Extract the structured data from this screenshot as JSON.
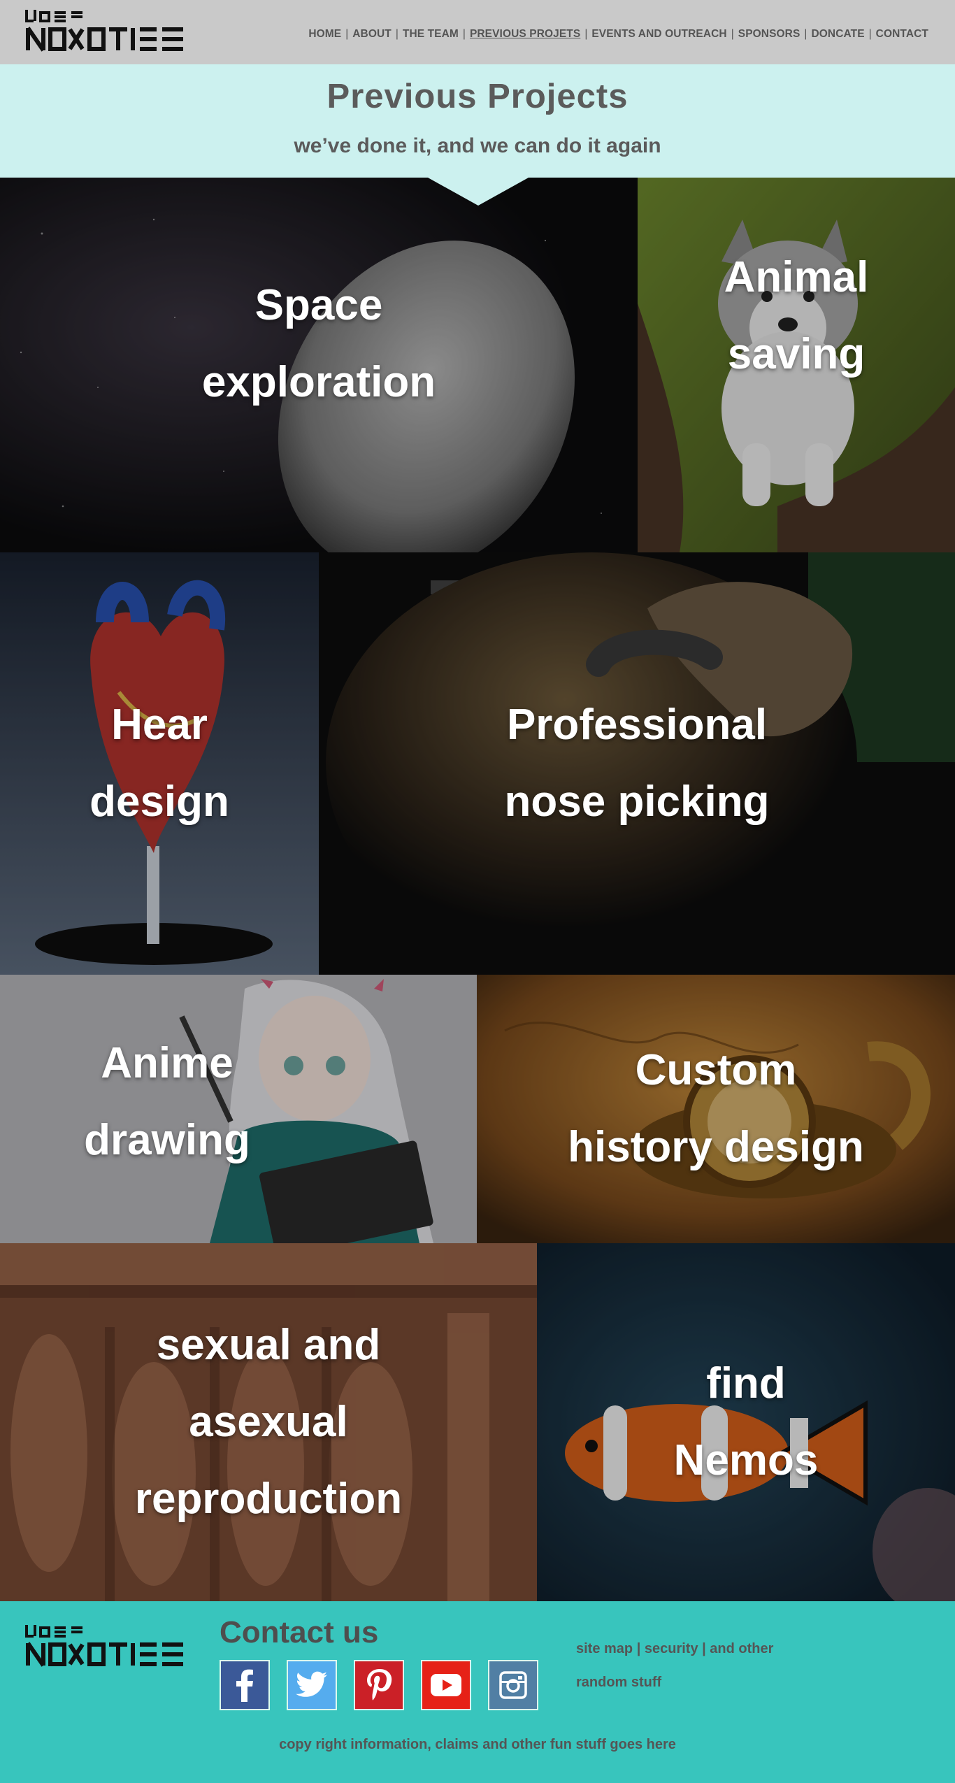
{
  "logo": {
    "alt": "team logo"
  },
  "nav": {
    "items": [
      {
        "label": "HOME"
      },
      {
        "label": "ABOUT"
      },
      {
        "label": "THE TEAM"
      },
      {
        "label": "PREVIOUS PROJETS"
      },
      {
        "label": "EVENTS AND OUTREACH"
      },
      {
        "label": "SPONSORS"
      },
      {
        "label": "DONCATE"
      },
      {
        "label": "CONTACT"
      }
    ],
    "separator": "|"
  },
  "hero": {
    "title": "Previous Projects",
    "subtitle": "we’ve done it, and we can do it again"
  },
  "projects": [
    {
      "line1": "Space",
      "line2": "exploration"
    },
    {
      "line1": "Animal",
      "line2": "saving"
    },
    {
      "line1": "Hear",
      "line2": "design"
    },
    {
      "line1": "Professional",
      "line2": "nose picking"
    },
    {
      "line1": "Anime",
      "line2": "drawing"
    },
    {
      "line1": "Custom",
      "line2": "history design"
    },
    {
      "line1": "sexual and",
      "line2": "asexual",
      "line3": "reproduction"
    },
    {
      "line1": "find",
      "line2": "Nemos"
    }
  ],
  "footer": {
    "contact_title": "Contact us",
    "social_icons": [
      "facebook-icon",
      "twitter-icon",
      "pinterest-icon",
      "youtube-icon",
      "instagram-icon"
    ],
    "links_line1": "site map | security | and other",
    "links_line2": "random stuff",
    "copyright": "copy right information, claims and other fun stuff goes here"
  },
  "colors": {
    "header_bg": "#c9c9c9",
    "title_band_bg": "#ccf1ef",
    "footer_bg": "#38c5bd",
    "text_gray": "#5b5b5b",
    "facebook": "#3b5998",
    "twitter": "#55acee",
    "pinterest": "#cb2027",
    "youtube": "#e62117",
    "instagram": "#517fa4"
  }
}
